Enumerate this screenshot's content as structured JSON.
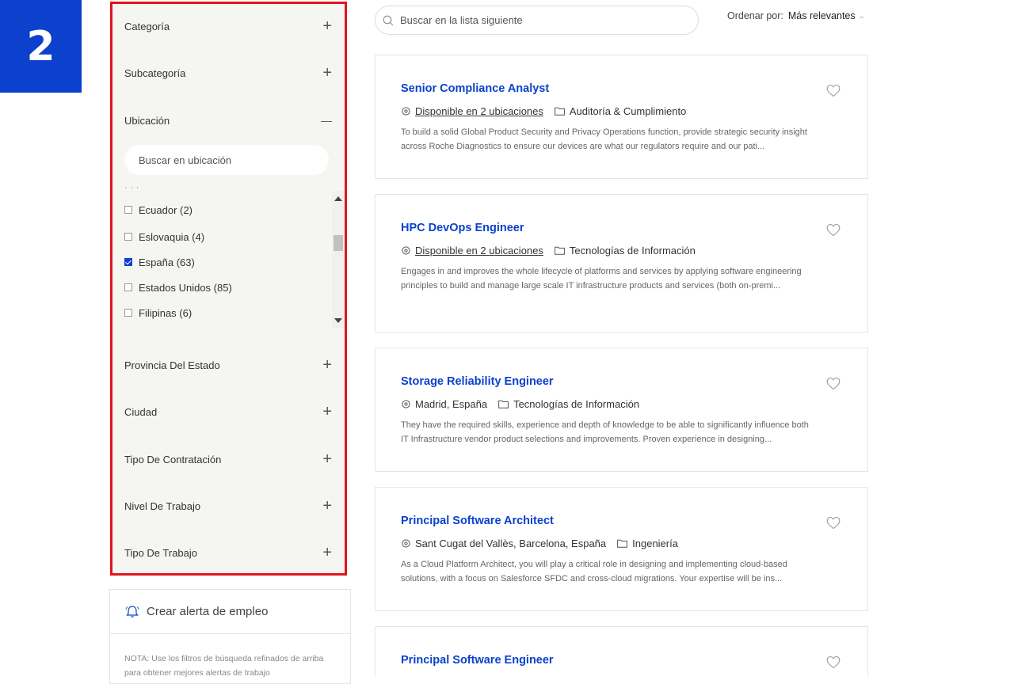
{
  "badge": "2",
  "filters": {
    "facets": [
      {
        "label": "Categoría",
        "toggle": "+"
      },
      {
        "label": "Subcategoría",
        "toggle": "+"
      },
      {
        "label": "Ubicación",
        "toggle": "—"
      },
      {
        "label": "Provincia Del Estado",
        "toggle": "+"
      },
      {
        "label": "Ciudad",
        "toggle": "+"
      },
      {
        "label": "Tipo De Contratación",
        "toggle": "+"
      },
      {
        "label": "Nivel De Trabajo",
        "toggle": "+"
      },
      {
        "label": "Tipo De Trabajo",
        "toggle": "+"
      }
    ],
    "location_search_placeholder": "Buscar en ubicación",
    "locations": [
      {
        "label": "Ecuador (2)",
        "checked": false
      },
      {
        "label": "Eslovaquia (4)",
        "checked": false
      },
      {
        "label": "España (63)",
        "checked": true
      },
      {
        "label": "Estados Unidos (85)",
        "checked": false
      },
      {
        "label": "Filipinas (6)",
        "checked": false
      }
    ]
  },
  "alert": {
    "title": "Crear alerta de empleo",
    "note": "NOTA: Use los filtros de búsqueda refinados de arriba para obtener mejores alertas de trabajo"
  },
  "search": {
    "placeholder": "Buscar en la lista siguiente"
  },
  "sort": {
    "label": "Ordenar por:",
    "value": "Más relevantes",
    "chevron": "⌄"
  },
  "jobs": [
    {
      "title": "Senior Compliance Analyst",
      "location": "Disponible en 2 ubicaciones",
      "category": "Auditoría & Cumplimiento",
      "description": "To build a solid Global Product Security and Privacy Operations function, provide strategic security insight across Roche Diagnostics to ensure our devices are what our regulators require and our pati..."
    },
    {
      "title": "HPC DevOps Engineer",
      "location": "Disponible en 2 ubicaciones",
      "category": "Tecnologías de Información",
      "description": "Engages in and improves the whole lifecycle of platforms and services by applying software engineering principles to build and manage large scale IT infrastructure products and services (both on-premi..."
    },
    {
      "title": "Storage Reliability Engineer",
      "location": "Madrid, España",
      "category": "Tecnologías de Información",
      "description": "They have the required skills, experience and depth of knowledge to be able to significantly influence both IT Infrastructure vendor product selections and improvements. Proven experience in designing..."
    },
    {
      "title": "Principal Software Architect",
      "location": "Sant Cugat del Vallès, Barcelona, España",
      "category": "Ingeniería",
      "description": "As a Cloud Platform Architect, you will play a critical role in designing and implementing cloud-based solutions, with a focus on Salesforce SFDC and cross-cloud migrations. Your expertise will be ins..."
    },
    {
      "title": "Principal Software Engineer",
      "location": "",
      "category": "",
      "description": ""
    }
  ]
}
